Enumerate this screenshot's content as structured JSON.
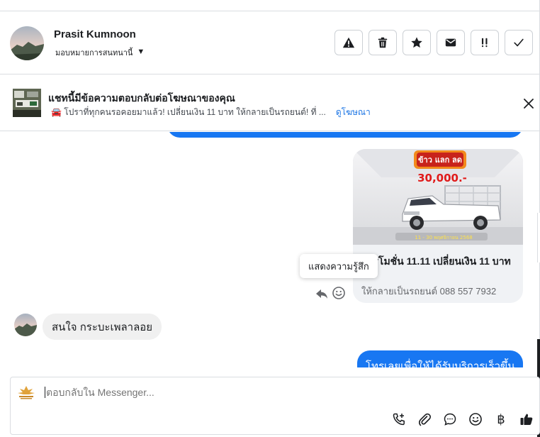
{
  "contact": {
    "name": "Prasit Kumnoon",
    "assign_label": "มอบหมายการสนทนานี้"
  },
  "header_actions": [
    {
      "name": "warning-icon",
      "label": "Spam"
    },
    {
      "name": "trash-icon",
      "label": "Delete"
    },
    {
      "name": "star-icon",
      "label": "Star"
    },
    {
      "name": "envelope-icon",
      "label": "Mark unread"
    },
    {
      "name": "follow-up-icon",
      "label": "Follow up"
    },
    {
      "name": "check-icon",
      "label": "Done"
    }
  ],
  "ad": {
    "title": "แชทนี้มีข้อความตอบกลับต่อโฆษณาของคุณ",
    "snippet": "🚘 โปราที่ทุกคนรอคอยมาแล้ว! เปลี่ยนเงิน 11 บาท ให้กลายเป็นรถยนต์! ที่ ...",
    "link": "ดูโฆษณา"
  },
  "card": {
    "image_badge": "ข้าว แลก ลด",
    "image_price": "30,000.-",
    "image_date": "11 - 30 พฤศจิกายน 2568",
    "title": "โปรโมชั่น 11.11 เปลี่ยนเงิน 11 บาท",
    "subtitle": "ให้กลายเป็นรถยนต์ 088 557 7932"
  },
  "tooltip": "แสดงความรู้สึก",
  "messages": {
    "incoming": "สนใจ กระบะเพลาลอย",
    "outgoing": "โทรเลยเพื่อให้ได้รับบริการเร็วขึ้น"
  },
  "composer": {
    "placeholder": "ตอบกลับใน Messenger..."
  },
  "colors": {
    "accent": "#1877f2",
    "bubble_in": "#f0f0f0",
    "link": "#1b74e4"
  }
}
